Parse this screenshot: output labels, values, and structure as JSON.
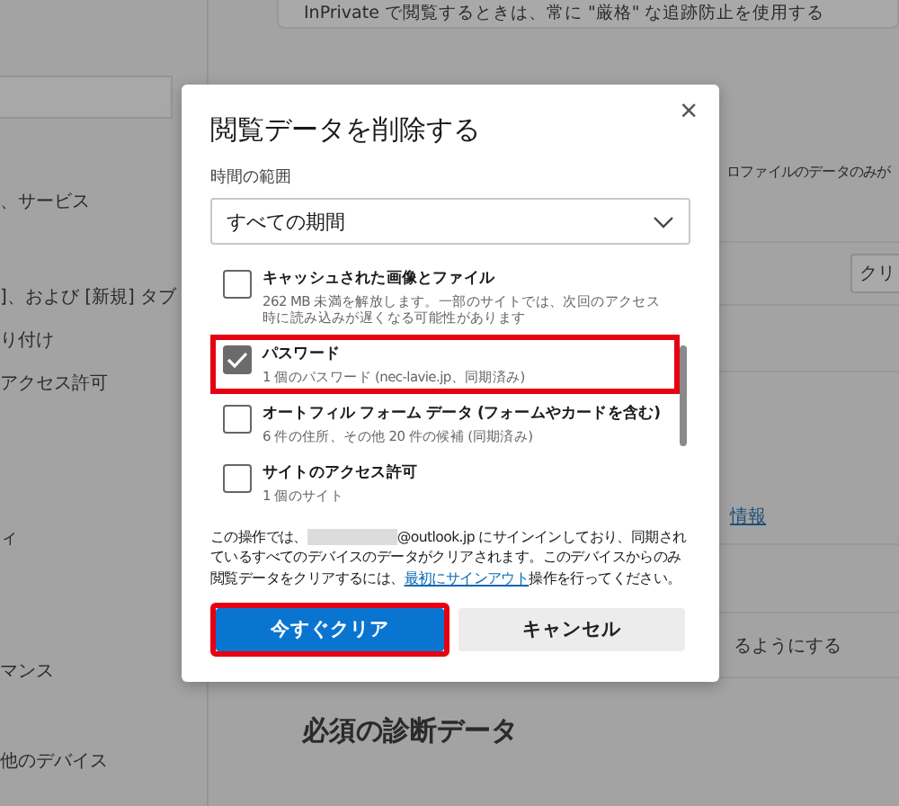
{
  "background": {
    "top_card_text": "InPrivate で閲覧するときは、常に \"厳格\" な追跡防止を使用する",
    "sidebar_items": [
      "、サービス",
      "]、および [新規] タブ",
      "り付け",
      "アクセス許可",
      "ィ",
      "マンス",
      "他のデバイス"
    ],
    "profile_text": "ロファイルのデータのみが",
    "clear_button": "クリ",
    "link": "情報",
    "setting_text": "るようにする",
    "section_heading": "必須の診断データ"
  },
  "dialog": {
    "title": "閲覧データを削除する",
    "close": "×",
    "range_label": "時間の範囲",
    "range_value": "すべての期間",
    "items": [
      {
        "label": "キャッシュされた画像とファイル",
        "description": "262 MB 未満を解放します。一部のサイトでは、次回のアクセス時に読み込みが遅くなる可能性があります",
        "checked": false,
        "highlighted": false
      },
      {
        "label": "パスワード",
        "description": "1 個のパスワード (nec-lavie.jp、同期済み)",
        "checked": true,
        "highlighted": true
      },
      {
        "label": "オートフィル フォーム データ (フォームやカードを含む)",
        "description": "6 件の住所、その他 20 件の候補 (同期済み)",
        "checked": false,
        "highlighted": false
      },
      {
        "label": "サイトのアクセス許可",
        "description": "1 個のサイト",
        "checked": false,
        "highlighted": false
      }
    ],
    "notice_before": "この操作では、",
    "notice_email": "@outlook.jp にサインインしており、同期されているすべてのデバイスのデータがクリアされます。このデバイスからのみ閲覧データをクリアするには、",
    "notice_link": "最初にサインアウト",
    "notice_after": "操作を行ってください。",
    "buttons": [
      {
        "label": "今すぐクリア",
        "kind": "primary",
        "highlighted": true
      },
      {
        "label": "キャンセル",
        "kind": "secondary",
        "highlighted": false
      }
    ]
  }
}
